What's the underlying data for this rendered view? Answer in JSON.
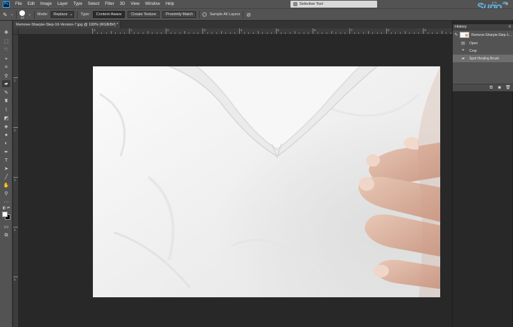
{
  "menubar": {
    "logo": "Ps",
    "items": [
      "File",
      "Edit",
      "Image",
      "Layer",
      "Type",
      "Select",
      "Filter",
      "3D",
      "View",
      "Window",
      "Help"
    ],
    "selective_tool": "Selective Tool",
    "watermark_brand": "Suno",
    "watermark_suffix": ".vn"
  },
  "options": {
    "brush_size": "14",
    "mode_label": "Mode:",
    "mode_value": "Replace",
    "type_label": "Type:",
    "type_buttons": [
      "Content-Aware",
      "Create Texture",
      "Proximity Match"
    ],
    "sample_all_layers": "Sample All Layers"
  },
  "tools": [
    "move-tool-icon",
    "marquee-tool-icon",
    "lasso-tool-icon",
    "quick-select-tool-icon",
    "crop-tool-icon",
    "eyedropper-tool-icon",
    "spot-healing-brush-icon",
    "brush-tool-icon",
    "clone-stamp-icon",
    "history-brush-icon",
    "eraser-tool-icon",
    "paint-bucket-icon",
    "blur-tool-icon",
    "dodge-tool-icon",
    "pen-tool-icon",
    "type-tool-icon",
    "path-select-icon",
    "shape-tool-icon",
    "hand-tool-icon",
    "zoom-tool-icon",
    "more-tools-icon"
  ],
  "colors": {
    "foreground": "#ffffff",
    "background": "#000000",
    "ui_bg": "#535353",
    "canvas_bg": "#282828",
    "accent": "#31a8ff"
  },
  "document": {
    "tab_title": "Remove-Sharpie-Step-16-Version-7.jpg @ 100% (RGB/8#) *",
    "close": "×"
  },
  "ruler_top_numbers": [
    "0",
    "1",
    "2",
    "3",
    "4",
    "5",
    "6",
    "7",
    "8",
    "9",
    "10",
    "11"
  ],
  "ruler_left_numbers": [
    "1",
    "2",
    "3",
    "4",
    "5"
  ],
  "history": {
    "title": "History",
    "snapshot_label": "Remove-Sharpie-Step-1...",
    "items": [
      {
        "label": "Open",
        "icon": "document-icon"
      },
      {
        "label": "Crop",
        "icon": "crop-icon"
      },
      {
        "label": "Spot Healing Brush",
        "icon": "healing-brush-icon"
      }
    ]
  }
}
